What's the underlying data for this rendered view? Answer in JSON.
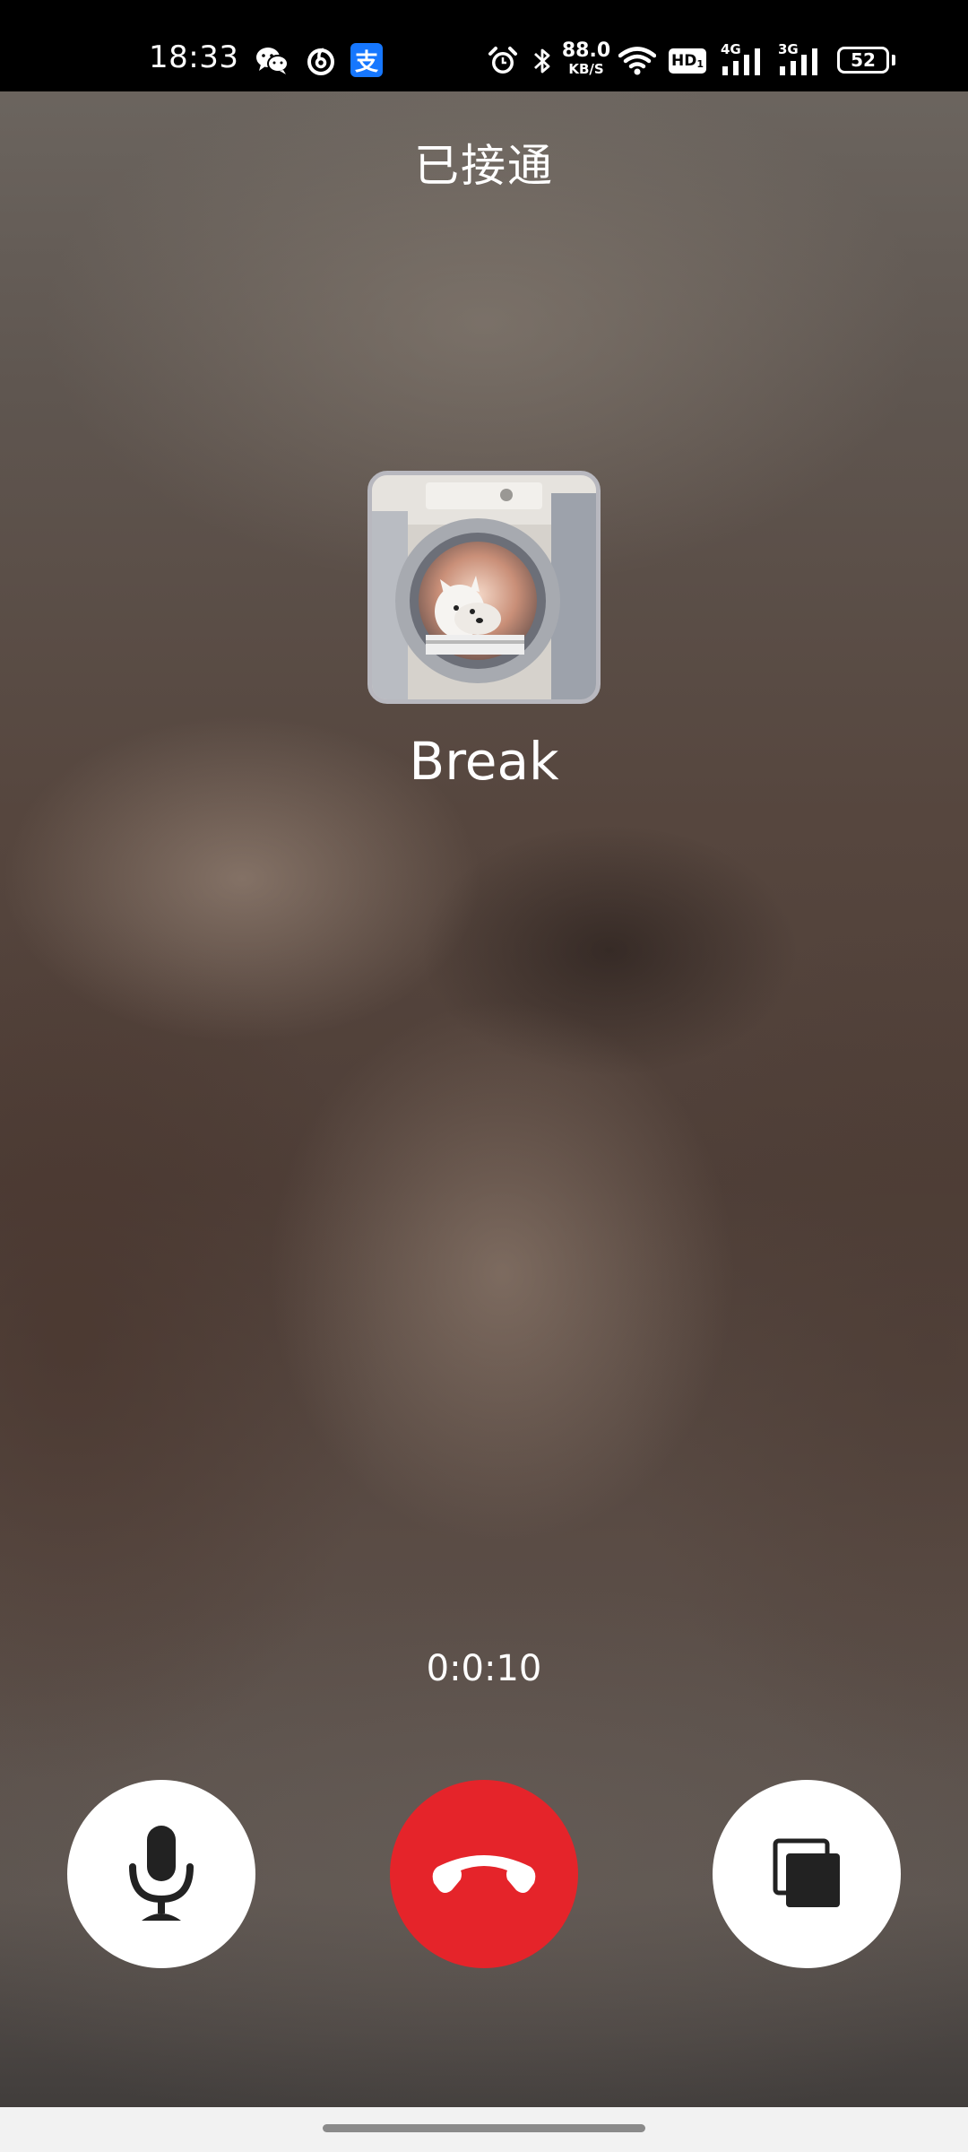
{
  "status_bar": {
    "time": "18:33",
    "net_speed_value": "88.0",
    "net_speed_unit": "KB/S",
    "hd_label": "HD",
    "hd_sub": "1",
    "sim1_label": "4G",
    "sim2_label": "3G",
    "battery": "52",
    "icons": [
      "wechat-icon",
      "netease-music-icon",
      "alipay-icon",
      "alarm-icon",
      "bluetooth-icon",
      "wifi-icon",
      "hd-icon",
      "signal-4g-icon",
      "signal-3g-icon",
      "battery-icon"
    ],
    "alipay_glyph": "支"
  },
  "call": {
    "status": "已接通",
    "contact_name": "Break",
    "timer": "0:0:10"
  },
  "controls": {
    "mute_icon": "microphone-icon",
    "end_icon": "hang-up-icon",
    "minimize_icon": "floating-window-icon",
    "end_color": "#e5242a"
  }
}
